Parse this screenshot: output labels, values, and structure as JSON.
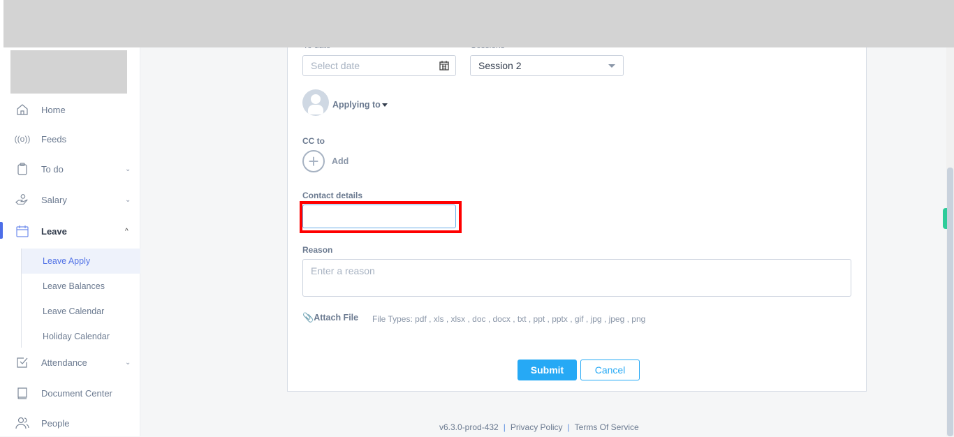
{
  "sidebar": {
    "items": [
      {
        "label": "Home",
        "icon": "home-icon"
      },
      {
        "label": "Feeds",
        "icon": "broadcast-icon"
      },
      {
        "label": "To do",
        "icon": "clipboard-icon",
        "chevron": "down"
      },
      {
        "label": "Salary",
        "icon": "hand-money-icon",
        "chevron": "down"
      },
      {
        "label": "Leave",
        "icon": "calendar-icon",
        "chevron": "up",
        "active": true
      },
      {
        "label": "Attendance",
        "icon": "checkbox-icon",
        "chevron": "down"
      },
      {
        "label": "Document Center",
        "icon": "book-icon"
      },
      {
        "label": "People",
        "icon": "people-icon"
      }
    ],
    "leave_sub": [
      "Leave Apply",
      "Leave Balances",
      "Leave Calendar",
      "Holiday Calendar"
    ]
  },
  "form": {
    "to_date_label": "To date",
    "to_date_placeholder": "Select date",
    "sessions_label": "Sessions",
    "sessions_value": "Session 2",
    "applying_to": "Applying to",
    "cc_label": "CC to",
    "cc_add": "Add",
    "contact_label": "Contact details",
    "contact_value": "",
    "reason_label": "Reason",
    "reason_placeholder": "Enter a reason",
    "attach_label": "Attach File",
    "file_types": "File Types: pdf , xls , xlsx , doc , docx , txt , ppt , pptx , gif , jpg , jpeg , png",
    "submit": "Submit",
    "cancel": "Cancel"
  },
  "footer": {
    "version": "v6.3.0-prod-432",
    "privacy": "Privacy Policy",
    "terms": "Terms Of Service"
  },
  "colors": {
    "primary": "#26a9f5",
    "highlight": "#ff0000",
    "active_nav": "#4d6ee8"
  }
}
